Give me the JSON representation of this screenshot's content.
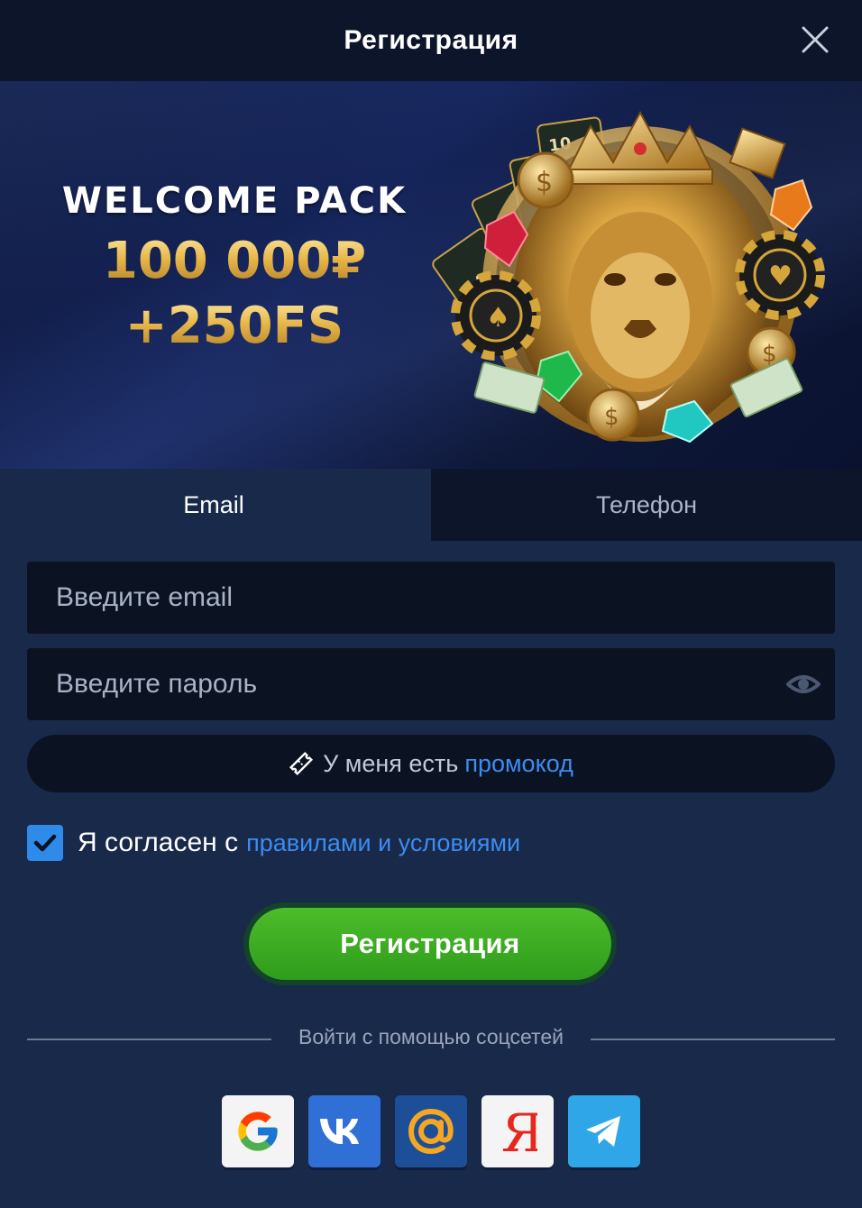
{
  "header": {
    "title": "Регистрация"
  },
  "banner": {
    "line1": "WELCOME PACK",
    "line2": "100 000₽",
    "line3": "+250FS"
  },
  "tabs": [
    {
      "label": "Email",
      "active": true
    },
    {
      "label": "Телефон",
      "active": false
    }
  ],
  "form": {
    "email_placeholder": "Введите email",
    "email_value": "",
    "password_placeholder": "Введите пароль",
    "password_value": "",
    "promo_text": "У меня есть",
    "promo_link": "промокод",
    "agree_text": "Я согласен с",
    "agree_link": "правилами и условиями",
    "agree_checked": true,
    "submit_label": "Регистрация"
  },
  "social": {
    "divider_text": "Войти с помощью соцсетей",
    "providers": [
      {
        "name": "google",
        "icon": "google-icon"
      },
      {
        "name": "vk",
        "icon": "vk-icon"
      },
      {
        "name": "mail",
        "icon": "mail-at-icon"
      },
      {
        "name": "yandex",
        "icon": "yandex-icon"
      },
      {
        "name": "telegram",
        "icon": "telegram-icon"
      }
    ]
  },
  "colors": {
    "background": "#18294a",
    "header": "#0d152a",
    "input": "#0b1222",
    "link": "#3d8cf0",
    "accent_green": "#3fae22",
    "checkbox": "#2e8bea"
  }
}
